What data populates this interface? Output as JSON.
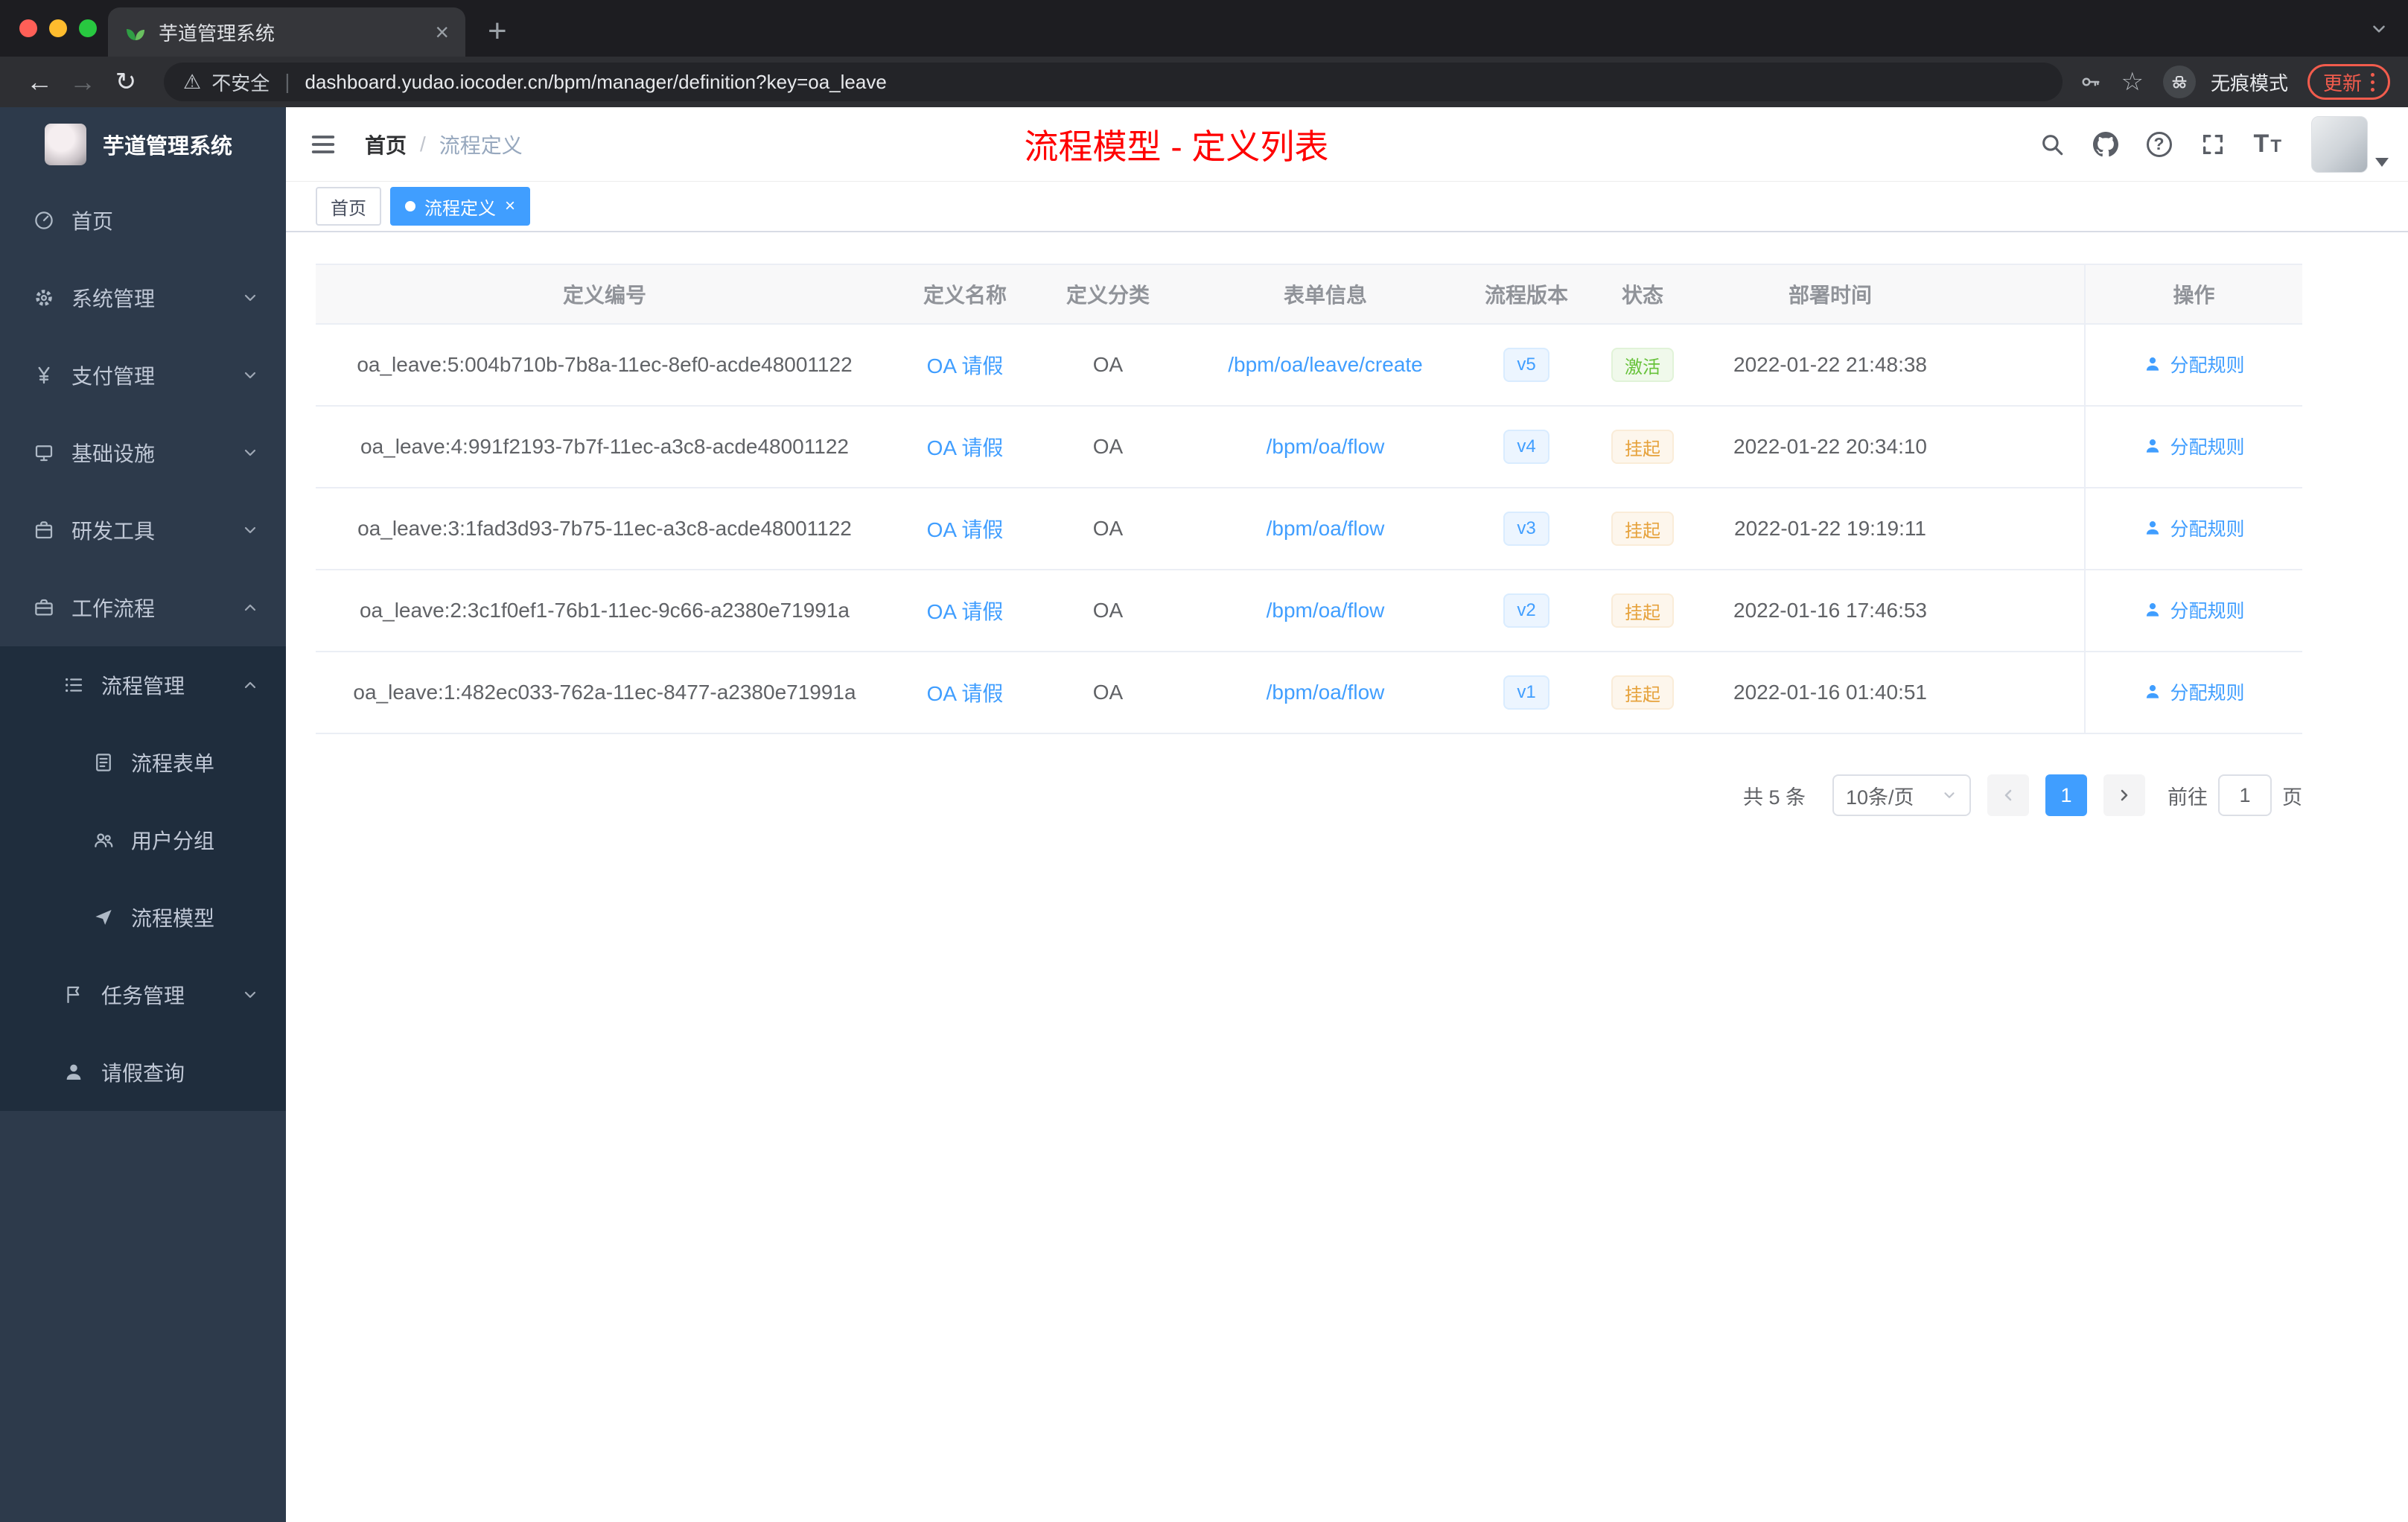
{
  "browser": {
    "tab_title": "芋道管理系统",
    "security": "不安全",
    "url": "dashboard.yudao.iocoder.cn/bpm/manager/definition?key=oa_leave",
    "incognito": "无痕模式",
    "update": "更新"
  },
  "sidebar": {
    "title": "芋道管理系统",
    "items": [
      {
        "label": "首页",
        "icon": "dashboard-icon",
        "level": 1,
        "arrow": "",
        "dark": false
      },
      {
        "label": "系统管理",
        "icon": "gear-icon",
        "level": 1,
        "arrow": "down",
        "dark": false
      },
      {
        "label": "支付管理",
        "icon": "yen-icon",
        "level": 1,
        "arrow": "down",
        "dark": false
      },
      {
        "label": "基础设施",
        "icon": "infra-icon",
        "level": 1,
        "arrow": "down",
        "dark": false
      },
      {
        "label": "研发工具",
        "icon": "tools-icon",
        "level": 1,
        "arrow": "down",
        "dark": false
      },
      {
        "label": "工作流程",
        "icon": "workflow-icon",
        "level": 1,
        "arrow": "up",
        "dark": false
      },
      {
        "label": "流程管理",
        "icon": "process-icon",
        "level": 2,
        "arrow": "up",
        "dark": true
      },
      {
        "label": "流程表单",
        "icon": "form-icon",
        "level": 3,
        "arrow": "",
        "dark": true
      },
      {
        "label": "用户分组",
        "icon": "group-icon",
        "level": 3,
        "arrow": "",
        "dark": true
      },
      {
        "label": "流程模型",
        "icon": "model-icon",
        "level": 3,
        "arrow": "",
        "dark": true
      },
      {
        "label": "任务管理",
        "icon": "task-icon",
        "level": 2,
        "arrow": "down",
        "dark": true
      },
      {
        "label": "请假查询",
        "icon": "user-icon",
        "level": 2,
        "arrow": "",
        "dark": true
      }
    ]
  },
  "header": {
    "breadcrumb": {
      "home": "首页",
      "sep": "/",
      "current": "流程定义"
    },
    "title": "流程模型 - 定义列表"
  },
  "tags": [
    {
      "label": "首页",
      "active": false
    },
    {
      "label": "流程定义",
      "active": true
    }
  ],
  "table": {
    "columns": [
      "定义编号",
      "定义名称",
      "定义分类",
      "表单信息",
      "流程版本",
      "状态",
      "部署时间",
      "操作"
    ],
    "rows": [
      {
        "id": "oa_leave:5:004b710b-7b8a-11ec-8ef0-acde48001122",
        "name": "OA 请假",
        "category": "OA",
        "form": "/bpm/oa/leave/create",
        "version": "v5",
        "status": "激活",
        "status_type": "success",
        "time": "2022-01-22 21:48:38",
        "action": "分配规则"
      },
      {
        "id": "oa_leave:4:991f2193-7b7f-11ec-a3c8-acde48001122",
        "name": "OA 请假",
        "category": "OA",
        "form": "/bpm/oa/flow",
        "version": "v4",
        "status": "挂起",
        "status_type": "warning",
        "time": "2022-01-22 20:34:10",
        "action": "分配规则"
      },
      {
        "id": "oa_leave:3:1fad3d93-7b75-11ec-a3c8-acde48001122",
        "name": "OA 请假",
        "category": "OA",
        "form": "/bpm/oa/flow",
        "version": "v3",
        "status": "挂起",
        "status_type": "warning",
        "time": "2022-01-22 19:19:11",
        "action": "分配规则"
      },
      {
        "id": "oa_leave:2:3c1f0ef1-76b1-11ec-9c66-a2380e71991a",
        "name": "OA 请假",
        "category": "OA",
        "form": "/bpm/oa/flow",
        "version": "v2",
        "status": "挂起",
        "status_type": "warning",
        "time": "2022-01-16 17:46:53",
        "action": "分配规则"
      },
      {
        "id": "oa_leave:1:482ec033-762a-11ec-8477-a2380e71991a",
        "name": "OA 请假",
        "category": "OA",
        "form": "/bpm/oa/flow",
        "version": "v1",
        "status": "挂起",
        "status_type": "warning",
        "time": "2022-01-16 01:40:51",
        "action": "分配规则"
      }
    ]
  },
  "pagination": {
    "total": "共 5 条",
    "page_size": "10条/页",
    "page": "1",
    "goto": "前往",
    "goto_value": "1",
    "unit": "页"
  },
  "colors": {
    "accent": "#409eff",
    "title_red": "#ff0000",
    "success": "#67c23a",
    "warning": "#e6a23c",
    "sidebar_bg": "#2d3a4b",
    "submenu_bg": "#1f2d3d"
  }
}
